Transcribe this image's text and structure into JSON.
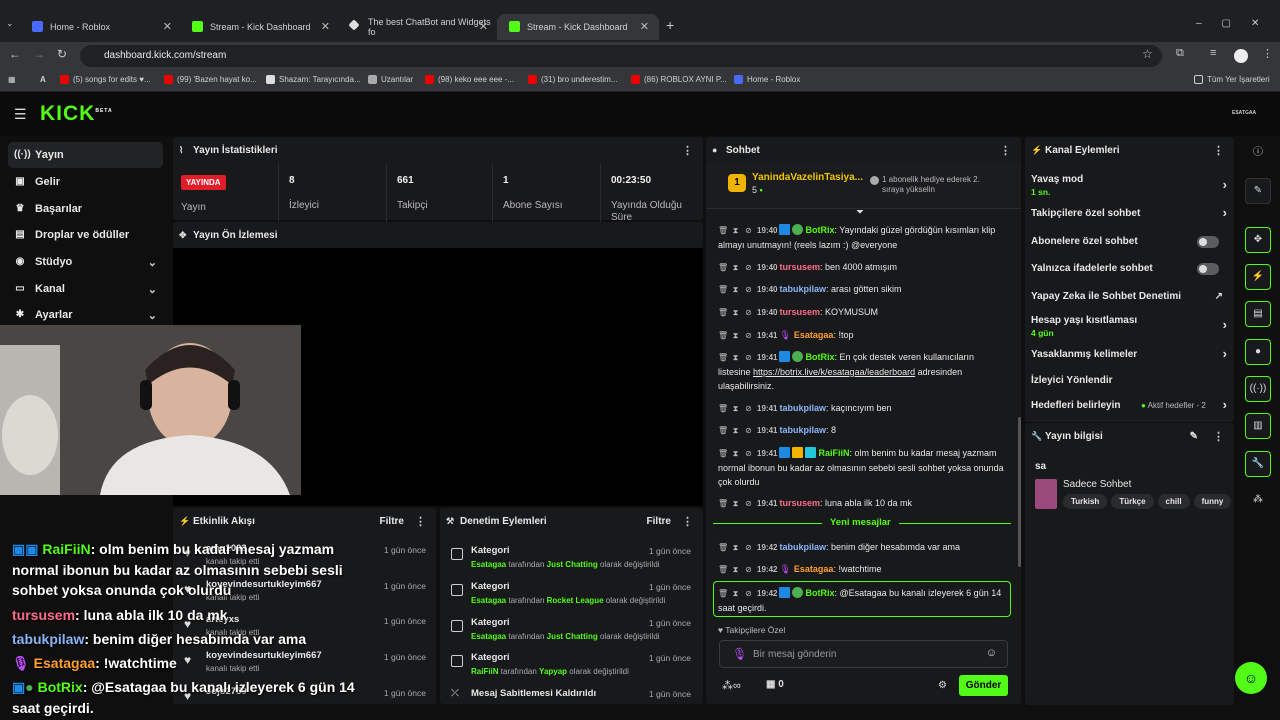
{
  "browser": {
    "tabs": [
      {
        "title": "Home - Roblox",
        "color": "#4a69ff"
      },
      {
        "title": "Stream - Kick Dashboard",
        "color": "#53fc18"
      },
      {
        "title": "The best ChatBot and Widgets fo",
        "color": "#dddddd"
      },
      {
        "title": "Stream - Kick Dashboard",
        "color": "#53fc18"
      }
    ],
    "url": "dashboard.kick.com/stream",
    "bookmarks": [
      "(5) songs for edits ♥...",
      "(99) 'Bazen hayat ko...",
      "Shazam: Tarayıcında...",
      "Uzantılar",
      "(98) keko eee eee -...",
      "(31) bro underestim...",
      "(86) ROBLOX AYNI P...",
      "Home - Roblox"
    ],
    "all_bookmarks": "Tüm Yer İşaretleri"
  },
  "brand": {
    "logo": "KICK",
    "beta": "BETA",
    "user": "ESATGAA"
  },
  "sidebar": {
    "items": [
      {
        "label": "Yayın",
        "icon": "broadcast-icon"
      },
      {
        "label": "Gelir",
        "icon": "revenue-icon"
      },
      {
        "label": "Başarılar",
        "icon": "trophy-icon"
      },
      {
        "label": "Droplar ve ödüller",
        "icon": "gift-icon"
      },
      {
        "label": "Stüdyo",
        "icon": "studio-icon"
      },
      {
        "label": "Kanal",
        "icon": "channel-icon"
      },
      {
        "label": "Ayarlar",
        "icon": "settings-icon"
      }
    ]
  },
  "stats": {
    "title": "Yayın İstatistikleri",
    "live_badge": "YAYINDA",
    "items": [
      {
        "label": "Yayın",
        "value": ""
      },
      {
        "label": "İzleyici",
        "value": "8"
      },
      {
        "label": "Takipçi",
        "value": "661"
      },
      {
        "label": "Abone Sayısı",
        "value": "1"
      },
      {
        "label": "Yayında Olduğu Süre",
        "value": "00:23:50"
      }
    ]
  },
  "preview": {
    "title": "Yayın Ön İzlemesi"
  },
  "overlay_chat": [
    {
      "user": "RaiFiiN",
      "text": ": olm benim bu kadar mesaj yazmam"
    },
    {
      "user": "",
      "text": "normal ibonun bu kadar az olmasının sebebi sesli"
    },
    {
      "user": "",
      "text": "sohbet yoksa onunda çok olurdu"
    },
    {
      "user": "tursusem",
      "text": ": luna abla ilk 10 da mk"
    },
    {
      "user": "tabukpilaw",
      "text": ": benim diğer hesabımda var ama"
    },
    {
      "user": "Esatagaa",
      "text": ": !watchtime"
    },
    {
      "user": "BotRix",
      "text": ": @Esatagaa bu kanalı izleyerek 6 gün 14"
    },
    {
      "user": "",
      "text": "saat geçirdi."
    }
  ],
  "activity": {
    "title": "Etkinlik Akışı",
    "filter": "Filtre",
    "items": [
      {
        "name": "amu1003",
        "sub": "kanalı takip etti",
        "time": "1 gün önce"
      },
      {
        "name": "koyevindesurtukleyim667",
        "sub": "kanalı takip etti",
        "time": "1 gün önce"
      },
      {
        "name": "arteyxs",
        "sub": "kanalı takip etti",
        "time": "1 gün önce"
      },
      {
        "name": "koyevindesurtukleyim667",
        "sub": "kanalı takip etti",
        "time": "1 gün önce"
      },
      {
        "name": "Jojo2759",
        "sub": "",
        "time": "1 gün önce"
      }
    ]
  },
  "moderation": {
    "title": "Denetim Eylemleri",
    "filter": "Filtre",
    "items": [
      {
        "name": "Kategori",
        "who": "Esatagaa",
        "mid": " tarafından ",
        "what": "Just Chatting",
        "end": " olarak değiştirildi",
        "time": "1 gün önce"
      },
      {
        "name": "Kategori",
        "who": "Esatagaa",
        "mid": " tarafından ",
        "what": "Rocket League",
        "end": " olarak değiştirildi",
        "time": "1 gün önce"
      },
      {
        "name": "Kategori",
        "who": "Esatagaa",
        "mid": " tarafından ",
        "what": "Just Chatting",
        "end": " olarak değiştirildi",
        "time": "1 gün önce"
      },
      {
        "name": "Kategori",
        "who": "RaiFiiN",
        "mid": " tarafından ",
        "what": "Yapyap",
        "end": " olarak değiştirildi",
        "time": "1 gün önce"
      },
      {
        "name": "Mesaj Sabitlemesi Kaldırıldı",
        "who": "",
        "mid": "",
        "what": "",
        "end": "",
        "time": "1 gün önce"
      }
    ]
  },
  "chat": {
    "title": "Sohbet",
    "gift_user": "YanindaVazelinTasiya...",
    "gift_count": "5",
    "gift_rank": "1",
    "gift_note": "1 abonelik hediye ederek 2. sıraya yükselin",
    "new_messages": "Yeni mesajlar",
    "followers_only": "Takipçilere Özel",
    "placeholder": "Bir mesaj gönderin",
    "send": "Gönder",
    "count": "0",
    "messages": [
      {
        "time": "19:40",
        "user": "BotRix",
        "color": "#53fc18",
        "text": ": Yayındaki güzel gördüğün kısımları klip almayı unutmayın! (reels lazım :) @everyone"
      },
      {
        "time": "19:40",
        "user": "tursusem",
        "color": "#ff6b8a",
        "text": ": ben 4000 atmışım"
      },
      {
        "time": "19:40",
        "user": "tabukpilaw",
        "color": "#8ab4f8",
        "text": ": arası götten sikim"
      },
      {
        "time": "19:40",
        "user": "tursusem",
        "color": "#ff6b8a",
        "text": ": KOYMUSUM"
      },
      {
        "time": "19:41",
        "user": "Esatagaa",
        "color": "#ff9f2e",
        "text": ": !top"
      },
      {
        "time": "19:41",
        "user": "BotRix",
        "color": "#53fc18",
        "text": ": En çok destek veren kullanıcıların listesine ",
        "link": "https://botrix.live/k/esatagaa/leaderboard",
        "after": " adresinden ulaşabilirsiniz."
      },
      {
        "time": "19:41",
        "user": "tabukpilaw",
        "color": "#8ab4f8",
        "text": ": kaçıncıyım ben"
      },
      {
        "time": "19:41",
        "user": "tabukpilaw",
        "color": "#8ab4f8",
        "text": ": 8"
      },
      {
        "time": "19:41",
        "user": "RaiFiiN",
        "color": "#53fc18",
        "text": ": olm benim bu kadar mesaj yazmam normal ibonun bu kadar az olmasının sebebi sesli sohbet yoksa onunda çok olurdu"
      },
      {
        "time": "19:41",
        "user": "tursusem",
        "color": "#ff6b8a",
        "text": ": luna abla ilk 10 da mk"
      },
      {
        "time": "19:42",
        "user": "tabukpilaw",
        "color": "#8ab4f8",
        "text": ": benim diğer hesabımda var ama"
      },
      {
        "time": "19:42",
        "user": "Esatagaa",
        "color": "#ff9f2e",
        "text": ": !watchtime"
      },
      {
        "time": "19:42",
        "user": "BotRix",
        "color": "#53fc18",
        "text": ": @Esatagaa bu kanalı izleyerek 6 gün 14 saat geçirdi."
      }
    ]
  },
  "channel_actions": {
    "title": "Kanal Eylemleri",
    "items": [
      {
        "label": "Yavaş mod",
        "sub": "1 sn."
      },
      {
        "label": "Takipçilere özel sohbet",
        "sub": ""
      },
      {
        "label": "Abonelere özel sohbet",
        "sub": ""
      },
      {
        "label": "Yalnızca ifadelerle sohbet",
        "sub": ""
      },
      {
        "label": "Yapay Zeka ile Sohbet Denetimi",
        "sub": ""
      },
      {
        "label": "Hesap yaşı kısıtlaması",
        "sub": "4 gün"
      },
      {
        "label": "Yasaklanmış kelimeler",
        "sub": ""
      },
      {
        "label": "İzleyici Yönlendir",
        "sub": ""
      },
      {
        "label": "Hedefleri belirleyin",
        "sub": ""
      }
    ],
    "goals_status": "Aktif hedefler - 2"
  },
  "stream_info": {
    "title": "Yayın bilgisi",
    "stream_title": "sa",
    "category": "Sadece Sohbet",
    "tags": [
      "Turkish",
      "Türkçe",
      "chill",
      "funny"
    ]
  }
}
